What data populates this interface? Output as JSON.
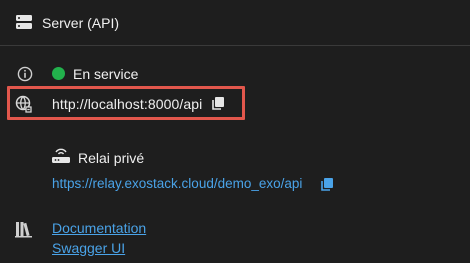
{
  "header": {
    "title": "Server (API)",
    "icon": "server-icon"
  },
  "status": {
    "icon": "info-icon",
    "label": "En service",
    "dot_color": "#22b14c"
  },
  "local": {
    "icon": "globe-network-icon",
    "url": "http://localhost:8000/api",
    "copy_icon": "copy-icon",
    "highlight_color": "#e2574c"
  },
  "relay": {
    "icon": "router-icon",
    "label": "Relai privé",
    "url": "https://relay.exostack.cloud/demo_exo/api",
    "copy_icon": "copy-icon"
  },
  "links": {
    "icon": "library-icon",
    "documentation": "Documentation",
    "swagger": "Swagger UI"
  },
  "colors": {
    "background": "#1e1e1e",
    "text": "#f0f0f0",
    "link": "#4aa3e8",
    "divider": "#3a3a3a"
  }
}
